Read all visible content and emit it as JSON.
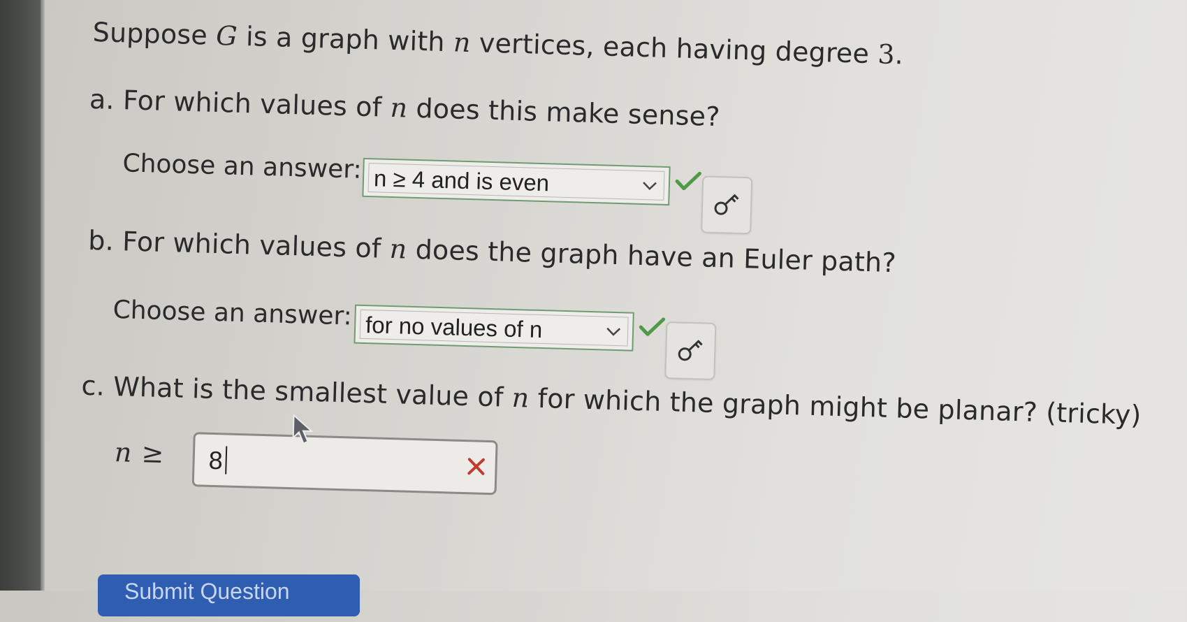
{
  "question": {
    "intro_pre": "Suppose ",
    "intro_var_g": "G",
    "intro_mid": " is a graph with ",
    "intro_var_n": "n",
    "intro_post": " vertices, each having degree ",
    "intro_num": "3",
    "intro_end": "."
  },
  "part_a": {
    "prefix": "a. For which values of ",
    "var": "n",
    "suffix": " does this make sense?",
    "choose_label": "Choose an answer:",
    "selected": "n ≥ 4 and is even",
    "status": "correct"
  },
  "part_b": {
    "prefix": "b. For which values of ",
    "var": "n",
    "suffix": " does the graph have an Euler path?",
    "choose_label": "Choose an answer:",
    "selected": "for no values of n",
    "status": "correct"
  },
  "part_c": {
    "prefix": "c. What is the smallest value of ",
    "var": "n",
    "suffix": " for which the graph might be planar? (tricky)",
    "input_label_var": "n",
    "input_label_op": "≥",
    "input_value": "8",
    "status": "incorrect"
  },
  "submit_label": "Submit Question",
  "colors": {
    "correct": "#4f9a47",
    "incorrect": "#c23b2e",
    "button": "#2f5db0"
  },
  "icons": [
    "check-icon",
    "chevron-down-icon",
    "hint-key-icon",
    "x-icon",
    "mouse-pointer-icon"
  ]
}
